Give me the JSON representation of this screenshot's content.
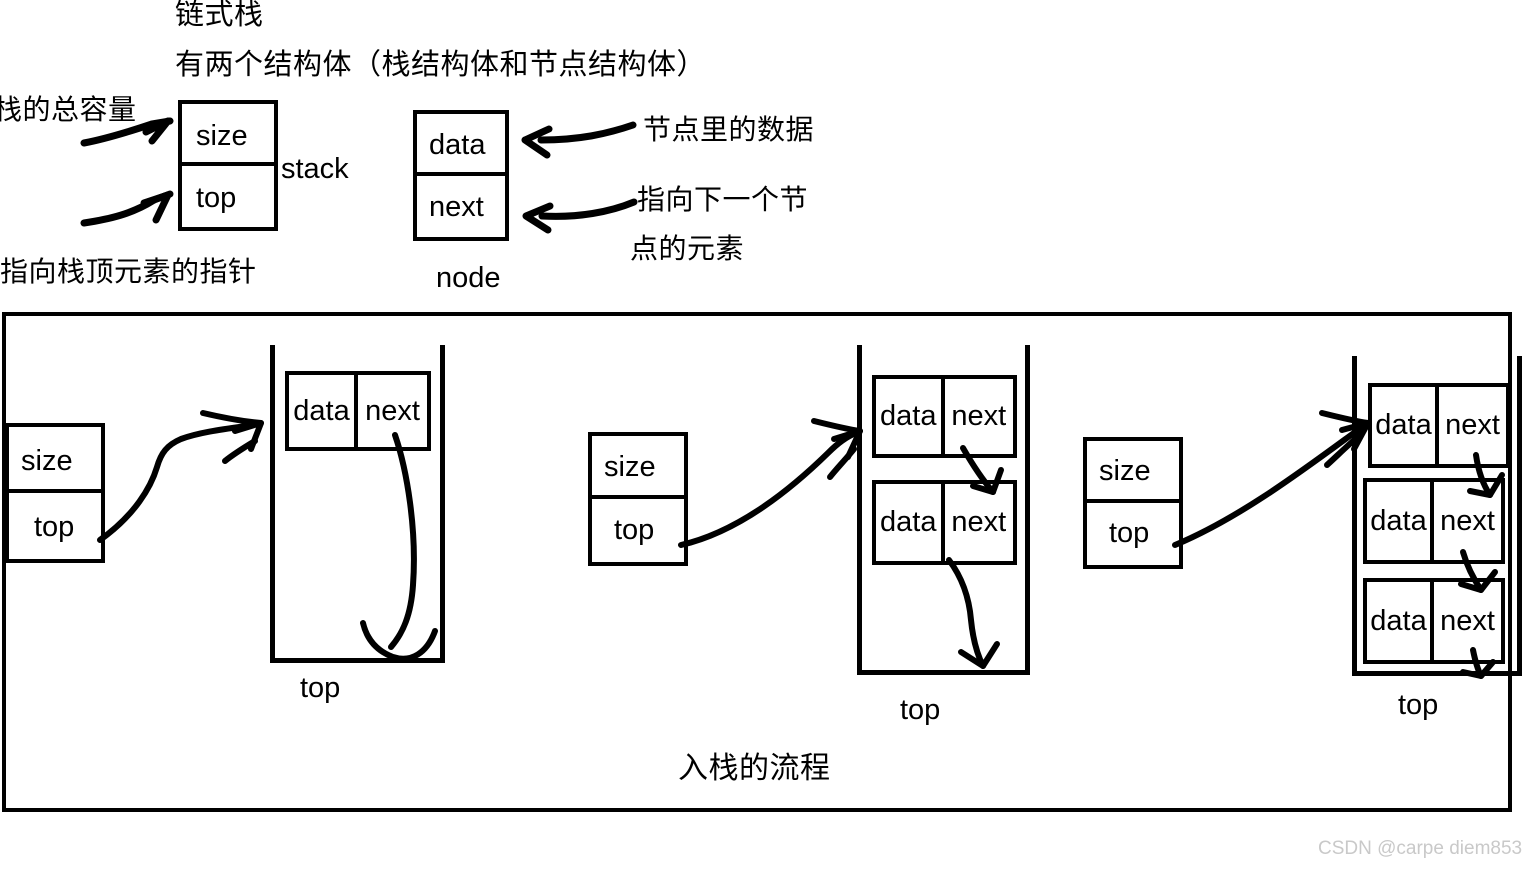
{
  "headings": {
    "title": "链式栈",
    "subtitle": "有两个结构体（栈结构体和节点结构体）"
  },
  "top_section": {
    "stack_struct": {
      "name_label": "stack",
      "fields": [
        "size",
        "top"
      ],
      "annotations": {
        "size_note": "栈的总容量",
        "top_note": "指向栈顶元素的指针"
      }
    },
    "node_struct": {
      "name_label": "node",
      "fields": [
        "data",
        "next"
      ],
      "annotations": {
        "data_note": "节点里的数据",
        "next_note_line1": "指向下一个节",
        "next_note_line2": "点的元素"
      }
    }
  },
  "bottom_section": {
    "caption": "入栈的流程",
    "steps": [
      {
        "stack_fields": [
          "size",
          "top"
        ],
        "container_label": "top",
        "nodes": [
          {
            "data": "data",
            "next": "next"
          }
        ]
      },
      {
        "stack_fields": [
          "size",
          "top"
        ],
        "container_label": "top",
        "nodes": [
          {
            "data": "data",
            "next": "next"
          },
          {
            "data": "data",
            "next": "next"
          }
        ]
      },
      {
        "stack_fields": [
          "size",
          "top"
        ],
        "container_label": "top",
        "nodes": [
          {
            "data": "data",
            "next": "next"
          },
          {
            "data": "data",
            "next": "next"
          },
          {
            "data": "data",
            "next": "next"
          }
        ]
      }
    ]
  },
  "watermark": "CSDN @carpe diem853",
  "colors": {
    "ink": "#000000",
    "background": "#ffffff",
    "watermark": "#c9c9c9"
  }
}
